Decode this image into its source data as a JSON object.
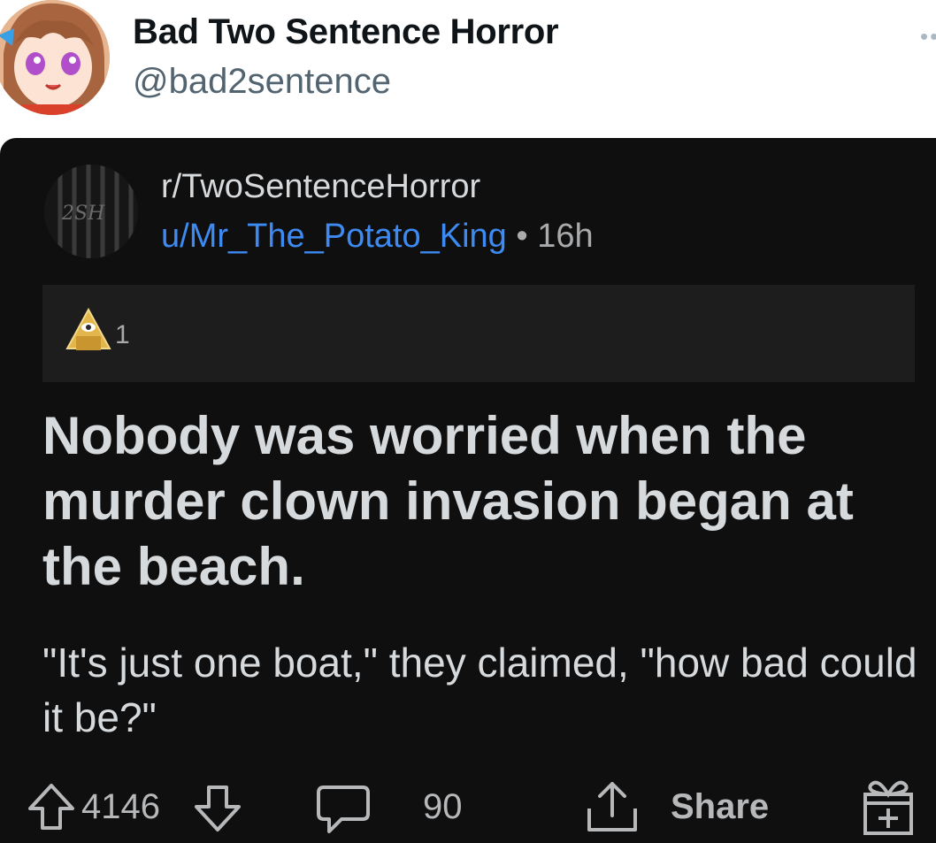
{
  "tweet": {
    "display_name": "Bad Two Sentence Horror",
    "handle": "@bad2sentence",
    "more_icon": "more-dots-icon"
  },
  "post": {
    "subreddit": "r/TwoSentenceHorror",
    "subreddit_icon_text": "2SH",
    "author": "u/Mr_The_Potato_King",
    "separator": " • ",
    "age": "16h",
    "award_icon": "illuminati-award-icon",
    "award_count": "1",
    "title": "Nobody was worried when the murder clown invasion began at the beach.",
    "body": "\"It's just one boat,\" they claimed, \"how bad could it be?\""
  },
  "actions": {
    "upvote_icon": "upvote-arrow-icon",
    "score": "4146",
    "downvote_icon": "downvote-arrow-icon",
    "comment_icon": "comment-bubble-icon",
    "comments": "90",
    "share_icon": "share-icon",
    "share_label": "Share",
    "gift_icon": "gift-award-icon"
  },
  "colors": {
    "card_background": "#0f0f10",
    "award_bar": "#1d1d1e",
    "link_blue": "#3d8bf2",
    "text_light": "#d7dadc",
    "text_muted": "#a8aaab"
  }
}
